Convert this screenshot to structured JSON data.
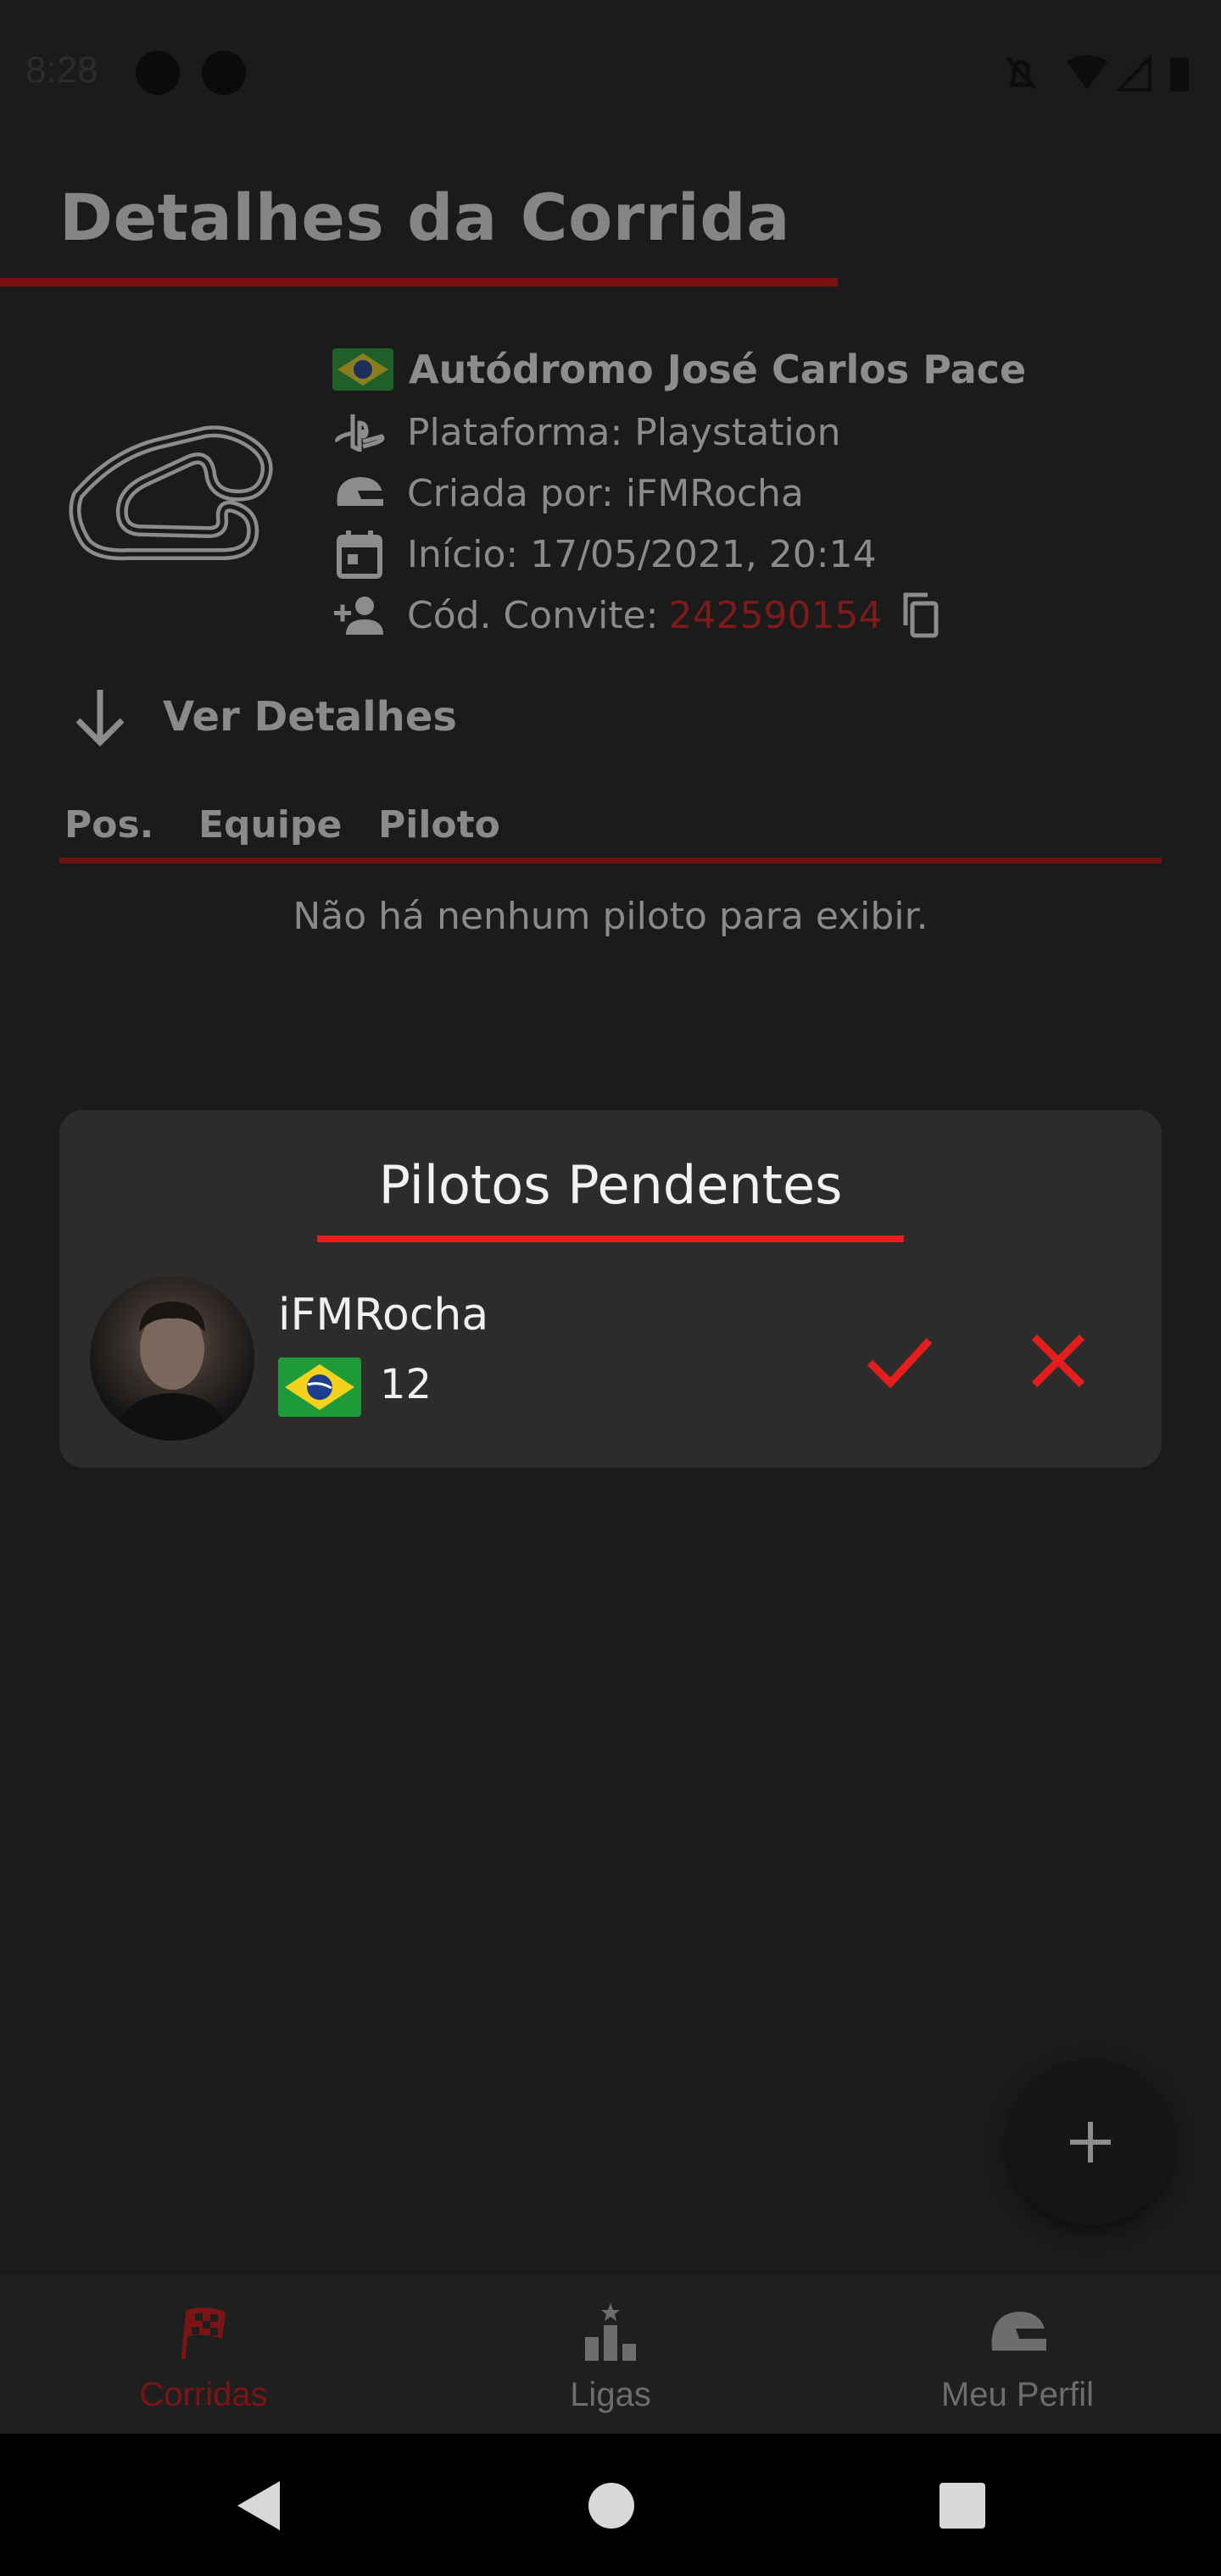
{
  "status_bar": {
    "time": "8:28"
  },
  "page": {
    "title": "Detalhes da Corrida"
  },
  "race": {
    "track_name": "Autódromo José Carlos Pace",
    "platform": "Plataforma: Playstation",
    "created_by": "Criada por: iFMRocha",
    "start": "Início: 17/05/2021, 20:14",
    "invite_label": "Cód. Convite:",
    "invite_code": "242590154"
  },
  "details_toggle": {
    "label": "Ver Detalhes"
  },
  "table": {
    "columns": [
      "Pos.",
      "Equipe",
      "Piloto"
    ],
    "empty_message": "Não há nenhum piloto para exibir."
  },
  "pending": {
    "title": "Pilotos Pendentes",
    "drivers": [
      {
        "name": "iFMRocha",
        "number": "12",
        "country_flag": "brazil-flag-icon"
      }
    ]
  },
  "bottom_nav": {
    "items": [
      {
        "label": "Corridas",
        "icon": "checkered-flag-icon",
        "active": true
      },
      {
        "label": "Ligas",
        "icon": "podium-icon",
        "active": false
      },
      {
        "label": "Meu Perfil",
        "icon": "helmet-icon",
        "active": false
      }
    ]
  },
  "colors": {
    "background": "#1b1b1b",
    "accent_red": "#e41d1d",
    "dim_red": "#7a1212",
    "card": "#2c2c2c"
  }
}
